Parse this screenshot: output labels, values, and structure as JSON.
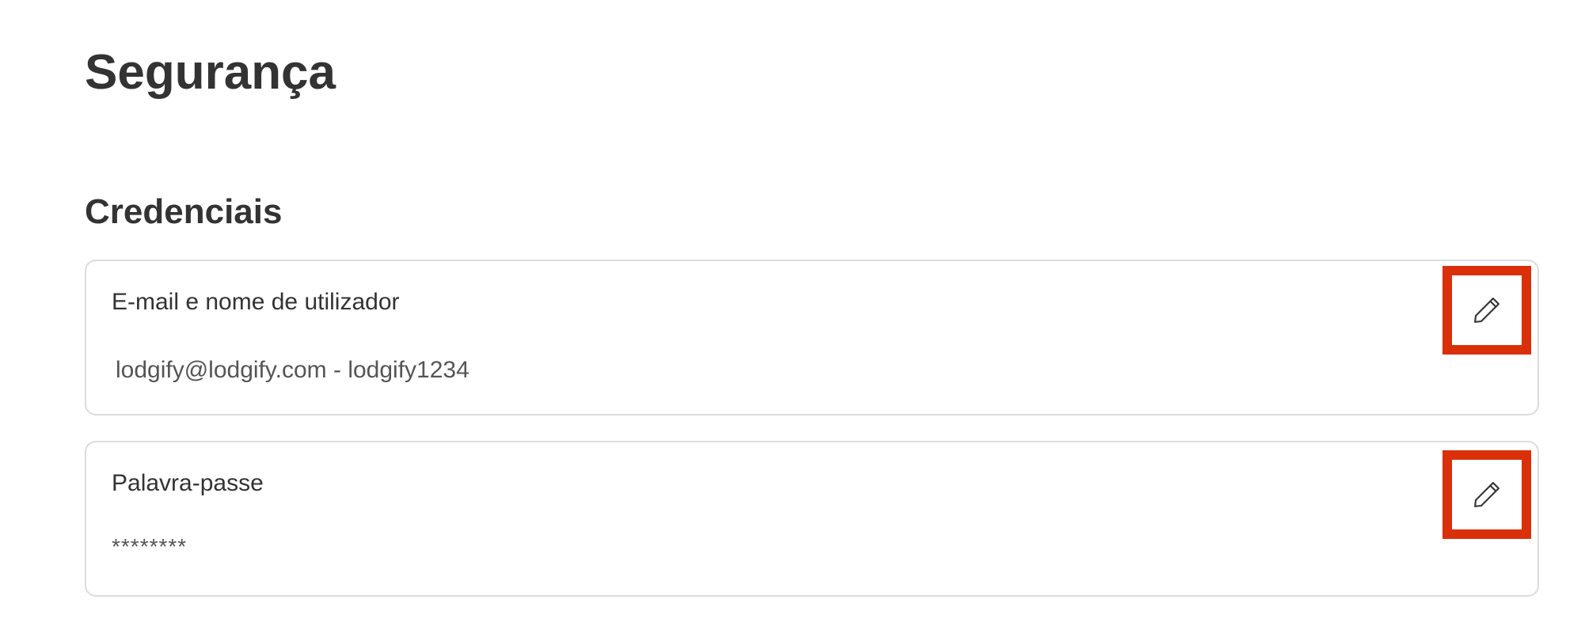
{
  "page": {
    "title": "Segurança"
  },
  "credentials": {
    "section_title": "Credenciais",
    "email_card": {
      "label": "E-mail e nome de utilizador",
      "value": "lodgify@lodgify.com - lodgify1234",
      "edit_icon": "pencil-icon"
    },
    "password_card": {
      "label": "Palavra-passe",
      "value": "********",
      "edit_icon": "pencil-icon"
    }
  },
  "colors": {
    "text": "#333333",
    "muted_text": "#555555",
    "card_border": "#dcdcdc",
    "highlight": "#d9300a"
  }
}
